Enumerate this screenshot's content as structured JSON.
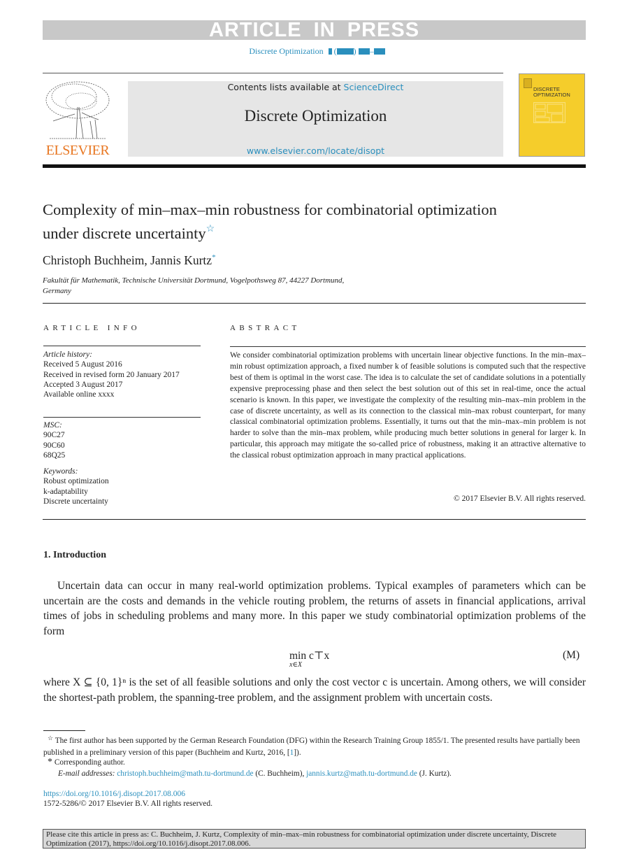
{
  "banner": {
    "text": "ARTICLE IN PRESS"
  },
  "running_head": {
    "journal": "Discrete Optimization"
  },
  "header": {
    "contents_prefix": "Contents lists available at ",
    "contents_link": "ScienceDirect",
    "journal_title": "Discrete Optimization",
    "journal_url": "www.elsevier.com/locate/disopt",
    "publisher": "ELSEVIER",
    "cover_title_line1": "DISCRETE",
    "cover_title_line2": "OPTIMIZATION",
    "colors": {
      "publisher_orange": "#e87722",
      "link_blue": "#2a8fbd",
      "cover_yellow": "#f5cd2b",
      "header_gray": "#e6e6e6"
    }
  },
  "paper": {
    "title": "Complexity of min–max–min robustness for combinatorial optimization under discrete uncertainty",
    "title_mark": "☆",
    "authors": "Christoph Buchheim, Jannis Kurtz",
    "author_mark": "*",
    "affiliation_line1": "Fakultät für Mathematik, Technische Universität Dortmund, Vogelpothsweg 87, 44227 Dortmund,",
    "affiliation_line2": "Germany"
  },
  "article_info": {
    "heading": "ARTICLE INFO",
    "history_label": "Article history:",
    "history": [
      "Received 5 August 2016",
      "Received in revised form 20 January 2017",
      "Accepted 3 August 2017",
      "Available online xxxx"
    ],
    "msc_label": "MSC:",
    "msc": [
      "90C27",
      "90C60",
      "68Q25"
    ],
    "keywords_label": "Keywords:",
    "keywords": [
      "Robust optimization",
      "k-adaptability",
      "Discrete uncertainty"
    ]
  },
  "abstract": {
    "heading": "ABSTRACT",
    "text": "We consider combinatorial optimization problems with uncertain linear objective functions. In the min–max–min robust optimization approach, a fixed number k of feasible solutions is computed such that the respective best of them is optimal in the worst case. The idea is to calculate the set of candidate solutions in a potentially expensive preprocessing phase and then select the best solution out of this set in real-time, once the actual scenario is known. In this paper, we investigate the complexity of the resulting min–max–min problem in the case of discrete uncertainty, as well as its connection to the classical min–max robust counterpart, for many classical combinatorial optimization problems. Essentially, it turns out that the min–max–min problem is not harder to solve than the min–max problem, while producing much better solutions in general for larger k. In particular, this approach may mitigate the so-called price of robustness, making it an attractive alternative to the classical robust optimization approach in many practical applications.",
    "copyright": "© 2017 Elsevier B.V. All rights reserved."
  },
  "body": {
    "section_title": "1. Introduction",
    "para1": "Uncertain data can occur in many real-world optimization problems. Typical examples of parameters which can be uncertain are the costs and demands in the vehicle routing problem, the returns of assets in financial applications, arrival times of jobs in scheduling problems and many more. In this paper we study combinatorial optimization problems of the form",
    "equation_main": "min  c⊤x",
    "equation_sub": "x∈X",
    "equation_label": "(M)",
    "para2": "where X ⊆ {0, 1}ⁿ is the set of all feasible solutions and only the cost vector c is uncertain. Among others, we will consider the shortest-path problem, the spanning-tree problem, and the assignment problem with uncertain costs."
  },
  "footnotes": {
    "fn1_mark": "☆",
    "fn1_text": " The first author has been supported by the German Research Foundation (DFG) within the Research Training Group 1855/1. The presented results have partially been published in a preliminary version of this paper (Buchheim and Kurtz, 2016, [",
    "fn1_ref": "1",
    "fn1_end": "]).",
    "fn2_mark": "*",
    "fn2_text": " Corresponding author.",
    "email_label": "E-mail addresses: ",
    "email1": "christoph.buchheim@math.tu-dortmund.de",
    "email1_name": " (C. Buchheim), ",
    "email2": "jannis.kurtz@math.tu-dortmund.de",
    "email2_name": " (J. Kurtz).",
    "doi": "https://doi.org/10.1016/j.disopt.2017.08.006",
    "issn": "1572-5286/© 2017 Elsevier B.V. All rights reserved."
  },
  "citation_box": {
    "text": "Please cite this article in press as: C. Buchheim, J. Kurtz, Complexity of min–max–min robustness for combinatorial optimization under discrete uncertainty, Discrete Optimization (2017), https://doi.org/10.1016/j.disopt.2017.08.006."
  }
}
